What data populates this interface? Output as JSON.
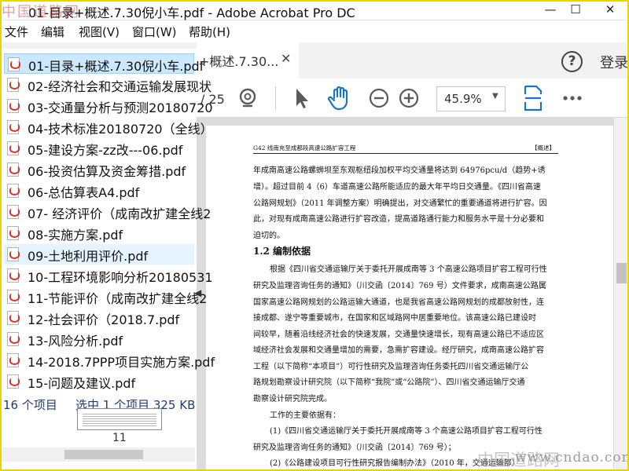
{
  "window": {
    "title": "01-目录+概述.7.30倪小车.pdf - Adobe Acrobat Pro DC",
    "watermark_top_left": "中国道路网",
    "minimize_glyph": "—",
    "maximize_glyph": "☐",
    "close_glyph": "✕"
  },
  "menu": [
    "文件",
    "编辑",
    "视图(V)",
    "窗口(W)",
    "帮助(H)"
  ],
  "tabrow": {
    "doc_tab_label": "+概述.7.30...",
    "doc_tab_close": "✕",
    "help_label": "?",
    "login_label": "登录"
  },
  "toolbar": {
    "page_total": "/ 25",
    "zoom_value": "45.9%",
    "zoom_caret": "▼",
    "icons": [
      "zoom-search-icon",
      "select-arrow-icon",
      "hand-tool-icon",
      "zoom-out-icon",
      "zoom-in-icon",
      "fit-page-icon",
      "more-icon"
    ]
  },
  "files": [
    {
      "name": "01-目录+概述.7.30倪小车.pdf",
      "state": "selected"
    },
    {
      "name": "02-经济社会和交通运输发展现状",
      "state": ""
    },
    {
      "name": "03-交通量分析与预测20180720",
      "state": ""
    },
    {
      "name": "04-技术标准20180720（全线）",
      "state": ""
    },
    {
      "name": "05-建设方案-zz改---06.pdf",
      "state": ""
    },
    {
      "name": "06-投资估算及资金筹措.pdf",
      "state": ""
    },
    {
      "name": "06-总估算表A4.pdf",
      "state": ""
    },
    {
      "name": "07- 经济评价（成南改扩建全线2",
      "state": ""
    },
    {
      "name": "08-实施方案.pdf",
      "state": ""
    },
    {
      "name": "09-土地利用评价.pdf",
      "state": "hover"
    },
    {
      "name": "10-工程环境影响分析20180531",
      "state": ""
    },
    {
      "name": "11-节能评价（成南改扩建全线2",
      "state": ""
    },
    {
      "name": "12-社会评价（2018.7.pdf",
      "state": ""
    },
    {
      "name": "13-风险分析.pdf",
      "state": ""
    },
    {
      "name": "14-2018.7PPP项目实施方案.pdf",
      "state": ""
    },
    {
      "name": "15-问题及建议.pdf",
      "state": ""
    }
  ],
  "status": {
    "count": "16 个项目",
    "selected": "选中 1 个项目  325 KB"
  },
  "thumbnail": {
    "page_number": "11"
  },
  "document": {
    "header_left": "G42 线南充至成都段高速公路扩容工程",
    "header_right": "【概述】",
    "lines_top": [
      "年成南高速公路螺蛳坝至东观枢纽段加权平均交通量将达到 64976pcu/d（趋势+诱",
      "增）。超过目前 4（6）车道高速公路所能适应的最大年平均日交通量。《四川省高速",
      "公路网规划》（2011 年调整方案）明确提出，对交通繁忙的重要通道将进行扩容。因",
      "此，对现有成南高速公路进行扩容改造，提高道路通行能力和服务水平是十分必要和",
      "迫切的。"
    ],
    "section_title": "1.2 编制依据",
    "lines_body": [
      "根据《四川省交通运输厅关于委托开展成南等 3 个高速公路项目扩容工程可行性",
      "研究及监理咨询任务的通知》（川交函〔2014〕769 号）文件要求，成南高速公路属",
      "国家高速公路网规划的公路运输大通道，也是我省高速公路网规划的成都放射性，连",
      "接成都、遂宁等重要城市，在国家和区域路网中居重要地位。该高速公路已建设时",
      "间较早，随着沿线经济社会的快速发展，交通量快速增长，现有高速公路已不适应区",
      "域经济社会发展和交通量增加的需要，急需扩容建设。经厅研究，成南高速公路扩容",
      "工程（以下简称“本项目”）可行性研究及监理咨询任务委托四川省交通运输厅公",
      "路规划勘察设计研究院（以下简称“我院”或“公路院”）、四川省交通运输厅交通",
      "勘察设计研究院完成。"
    ],
    "basis_intro": "工作的主要依据有：",
    "basis_items": [
      "(1)《四川省交通运输厅关于委托开展成南等 3 个高速公路项目扩容工程可行性",
      "研究及监理咨询任务的通知》（川交函〔2014〕769 号）；",
      "(2)《公路建设项目可行性研究报告编制办法》（2010 年，交通运输部）"
    ]
  },
  "watermark_bottom_right": {
    "url": "www.cndao.com",
    "cn": "中国道路网"
  },
  "colors": {
    "selected_row": "#cce8ff",
    "hover_row": "#e5f3ff",
    "status_text": "#1e3a7a",
    "pdf_red": "#d8312b",
    "frame": "#e8d400"
  }
}
